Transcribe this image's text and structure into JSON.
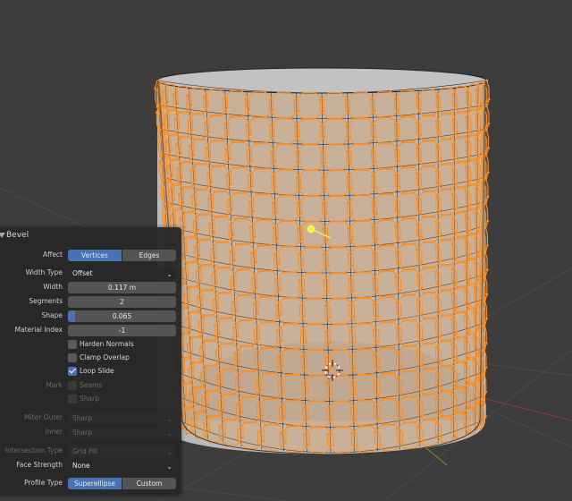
{
  "panel": {
    "title": "Bevel",
    "affect": {
      "label": "Affect",
      "options": [
        "Vertices",
        "Edges"
      ],
      "selected": "Vertices"
    },
    "width_type": {
      "label": "Width Type",
      "value": "Offset"
    },
    "width": {
      "label": "Width",
      "value": "0.117 m"
    },
    "segments": {
      "label": "Segments",
      "value": "2"
    },
    "shape": {
      "label": "Shape",
      "value": "0.065",
      "fraction": 0.065
    },
    "material_index": {
      "label": "Material Index",
      "value": "-1"
    },
    "harden_normals": {
      "label": "Harden Normals",
      "checked": false
    },
    "clamp_overlap": {
      "label": "Clamp Overlap",
      "checked": false
    },
    "loop_slide": {
      "label": "Loop Slide",
      "checked": true
    },
    "mark": {
      "label": "Mark",
      "seams": "Seams",
      "sharp": "Sharp"
    },
    "miter_outer": {
      "label": "Miter Outer",
      "value": "Sharp"
    },
    "inner": {
      "label": "Inner",
      "value": "Sharp"
    },
    "intersection_type": {
      "label": "Intersection Type",
      "value": "Grid Fill"
    },
    "face_strength": {
      "label": "Face Strength",
      "value": "None"
    },
    "profile_type": {
      "label": "Profile Type",
      "options": [
        "Superellipse",
        "Custom"
      ],
      "selected": "Superellipse"
    }
  },
  "colors": {
    "viewport_bg": "#3d3d3d",
    "selected_orange": "#ff8c1a",
    "mesh_gray": "#bcbcbc",
    "accent_blue": "#4772b3",
    "active_vertex": "#f2f24a"
  }
}
